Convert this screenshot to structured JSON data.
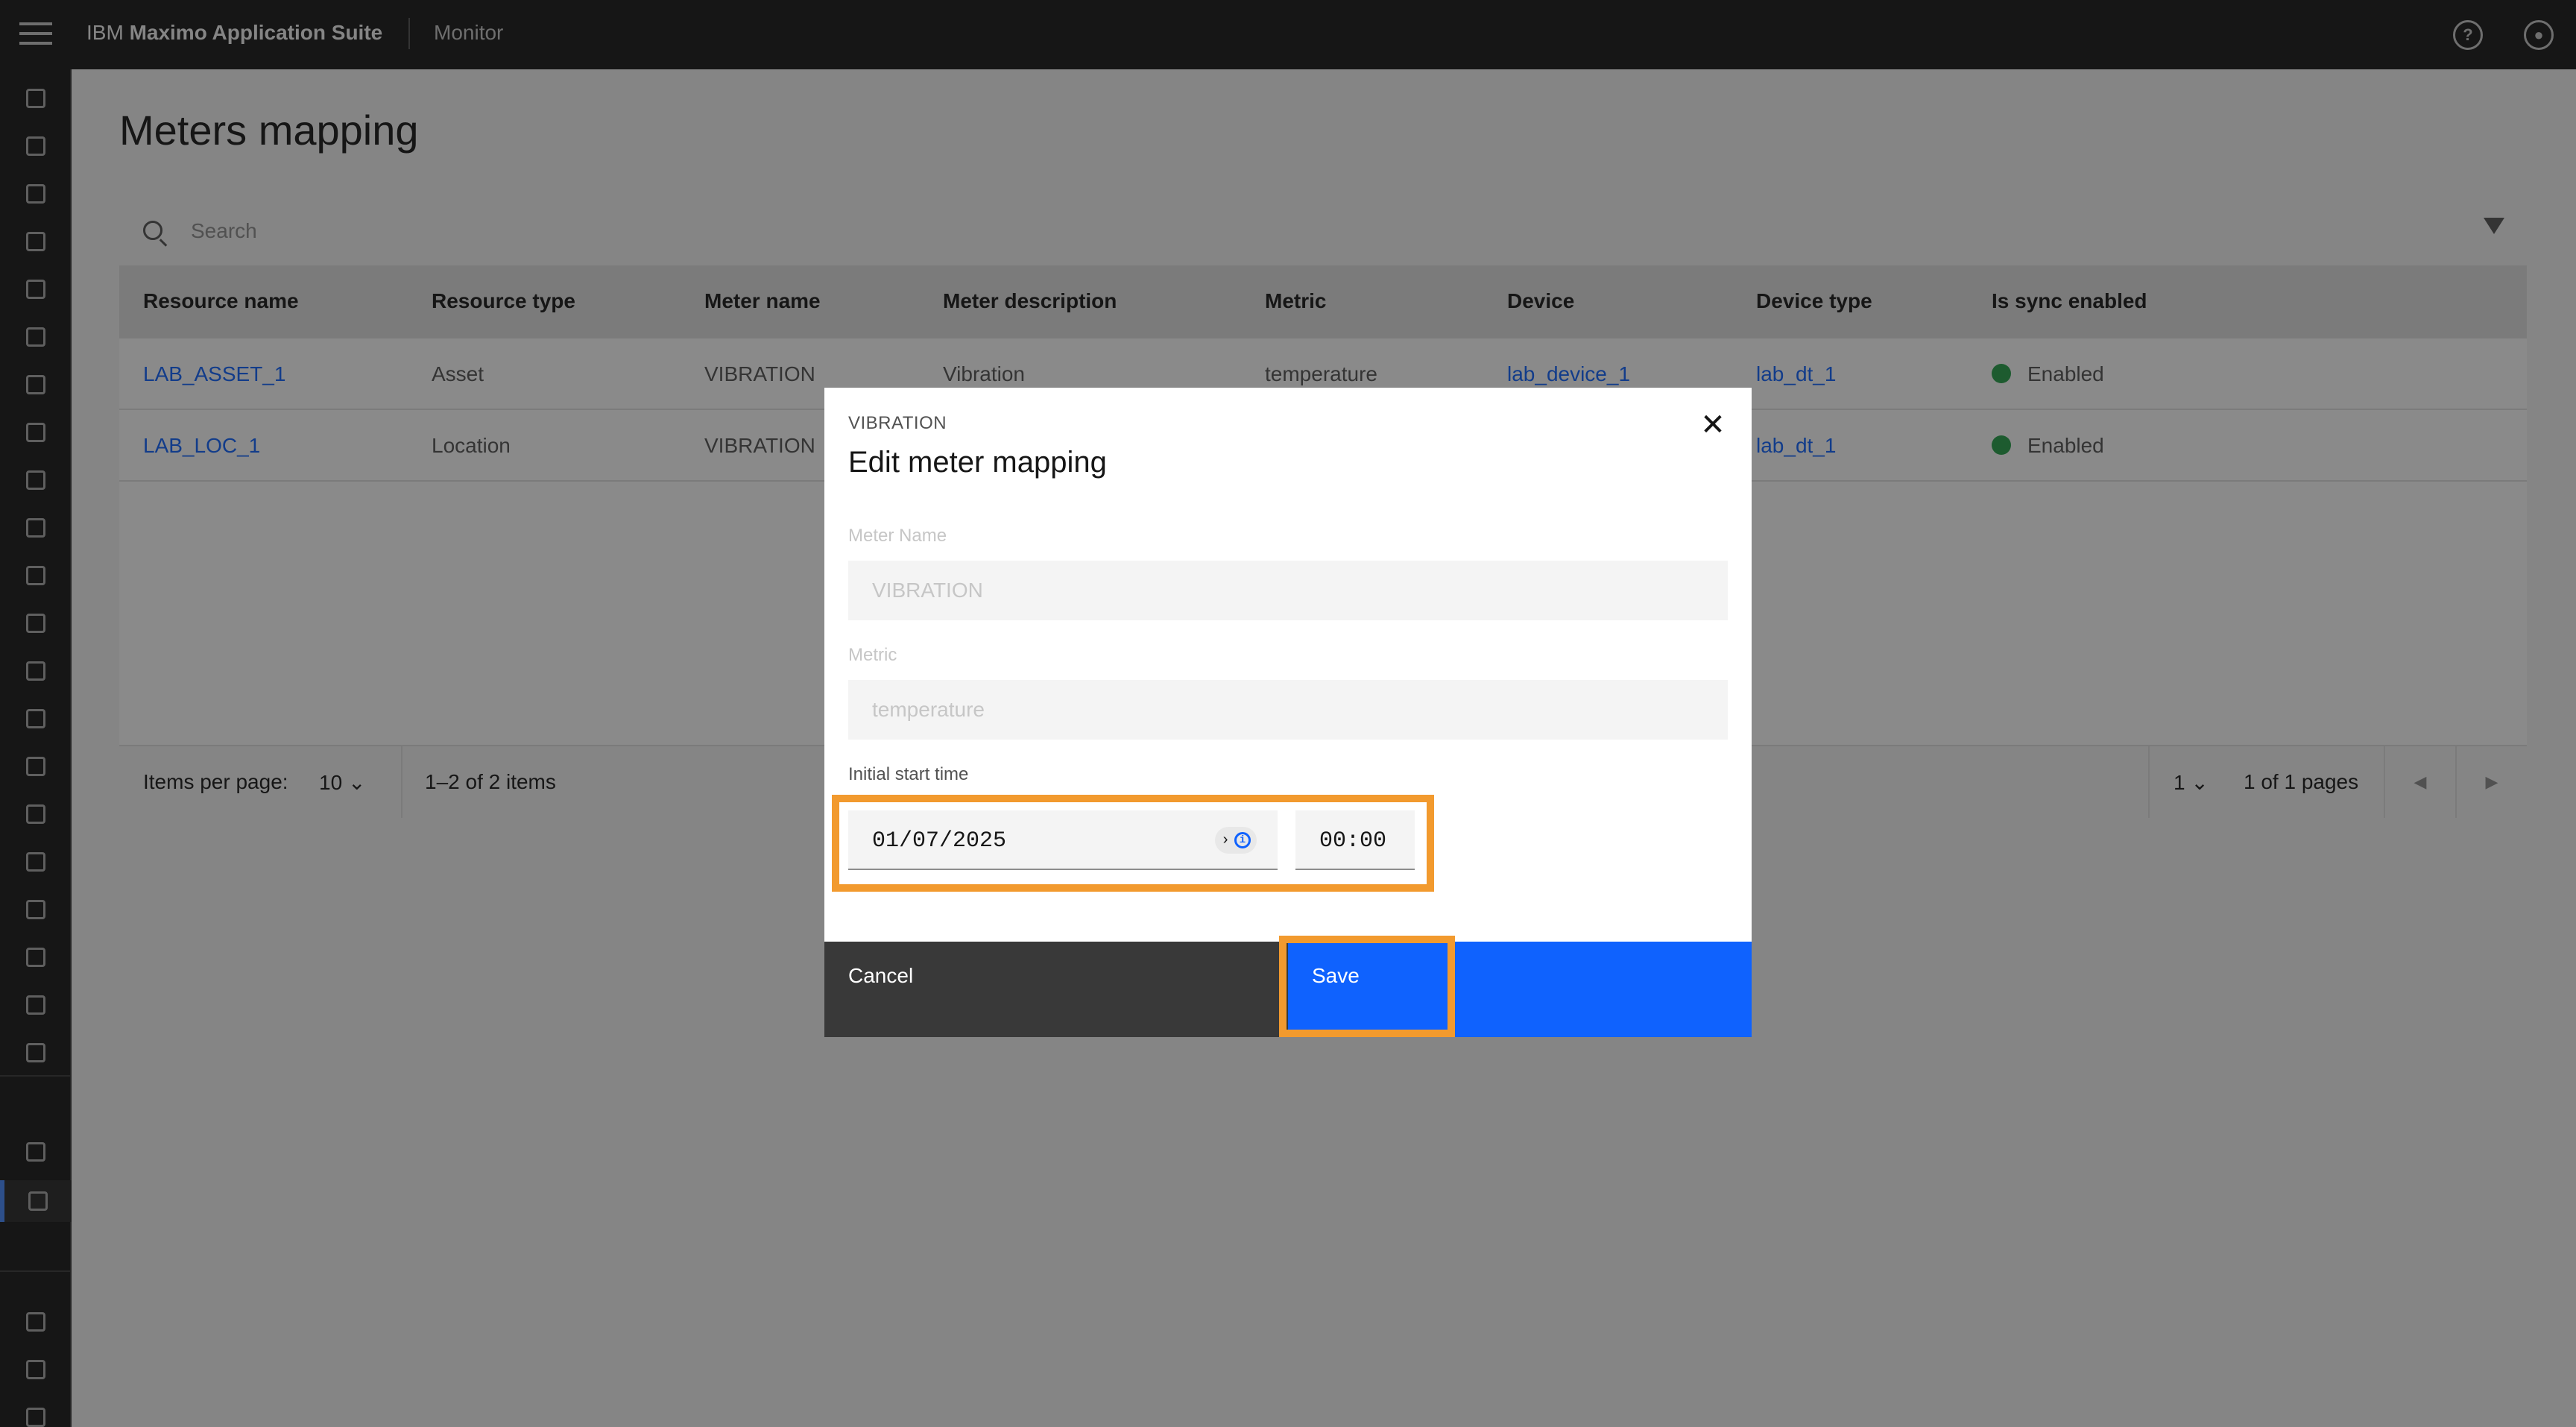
{
  "header": {
    "brand_prefix": "IBM",
    "brand_name": "Maximo Application Suite",
    "app_name": "Monitor",
    "help_icon": "help-icon",
    "user_icon": "user-avatar-icon"
  },
  "page": {
    "title": "Meters mapping"
  },
  "search": {
    "placeholder": "Search"
  },
  "table": {
    "columns": [
      "Resource name",
      "Resource type",
      "Meter name",
      "Meter description",
      "Metric",
      "Device",
      "Device type",
      "Is sync enabled"
    ],
    "rows": [
      {
        "resource_name": "LAB_ASSET_1",
        "resource_type": "Asset",
        "meter_name": "VIBRATION",
        "meter_description": "Vibration",
        "metric": "temperature",
        "device": "lab_device_1",
        "device_type": "lab_dt_1",
        "sync": "Enabled"
      },
      {
        "resource_name": "LAB_LOC_1",
        "resource_type": "Location",
        "meter_name": "VIBRATION",
        "meter_description": "",
        "metric": "",
        "device": "",
        "device_type": "lab_dt_1",
        "sync": "Enabled"
      }
    ],
    "status_color": "#24a148",
    "link_color": "#0f62fe"
  },
  "pagination": {
    "items_per_page_label": "Items per page:",
    "items_per_page_value": "10",
    "range_text": "1–2 of 2 items",
    "page_value": "1",
    "pages_text": "1 of 1 pages"
  },
  "modal": {
    "label": "VIBRATION",
    "title": "Edit meter mapping",
    "meter_name_label": "Meter Name",
    "meter_name_value": "VIBRATION",
    "metric_label": "Metric",
    "metric_value": "temperature",
    "start_time_label": "Initial start time",
    "date_value": "01/07/2025",
    "time_value": "00:00",
    "cancel_label": "Cancel",
    "save_label": "Save",
    "highlight_color": "#f29a2e",
    "primary_color": "#0f62fe"
  }
}
